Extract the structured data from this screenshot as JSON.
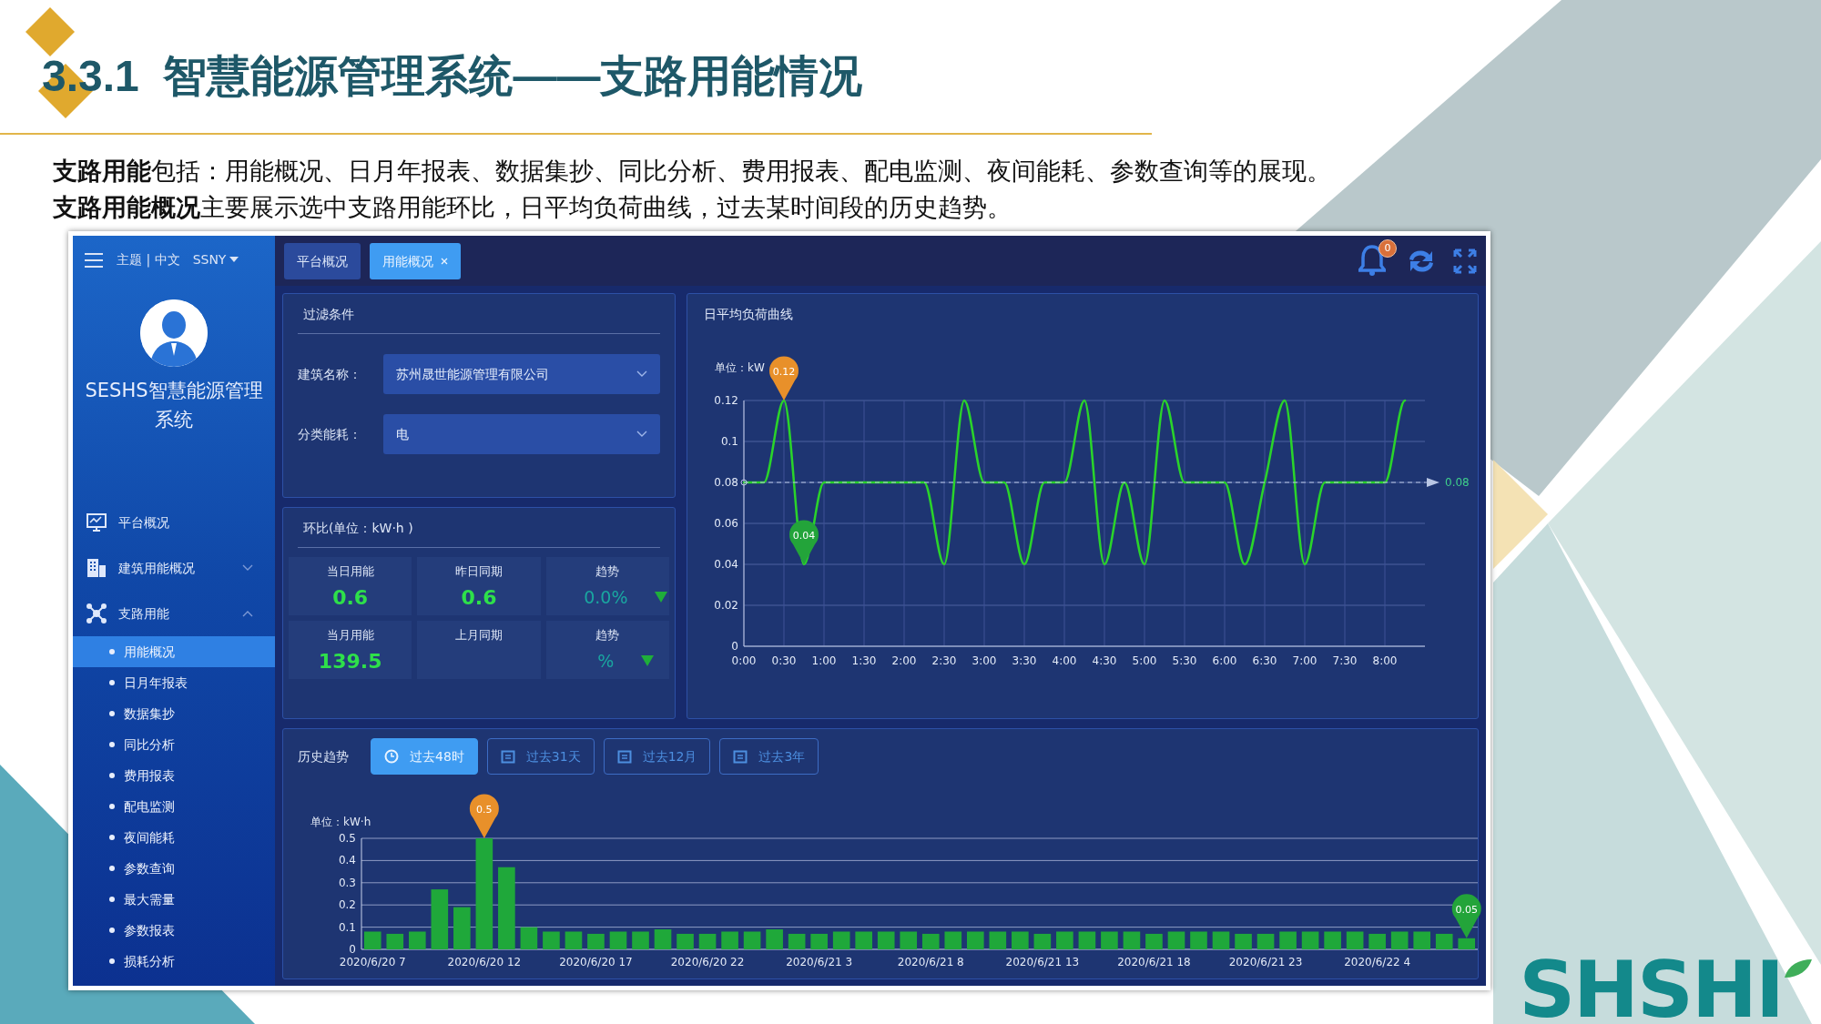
{
  "slide": {
    "title": "3.3.1  智慧能源管理系统——支路用能情况",
    "paragraphs": [
      "**支路用能**包括：用能概况、日月年报表、数据集抄、同比分析、费用报表、配电监测、夜间能耗、参数查询等的展现。",
      "**支路用能概况**主要展示选中支路用能环比，日平均负荷曲线，过去某时间段的历史趋势。"
    ],
    "logo": "SHSHI"
  },
  "app": {
    "topbar": {
      "theme_language": "主题 | 中文",
      "user": "SSNY",
      "notification_count": "0"
    },
    "tabs": [
      {
        "label": "平台概况",
        "selected": false,
        "closable": false
      },
      {
        "label": "用能概况",
        "selected": true,
        "closable": true
      }
    ],
    "sidebar": {
      "system_name": "SESHS智慧能源管理系统",
      "items": [
        {
          "label": "平台概况",
          "selected": false
        },
        {
          "label": "建筑用能概况",
          "selected": false,
          "expanded": false
        },
        {
          "label": "支路用能",
          "selected": false,
          "expanded": true,
          "children": [
            {
              "label": "用能概况",
              "selected": true
            },
            {
              "label": "日月年报表",
              "selected": false
            },
            {
              "label": "数据集抄",
              "selected": false
            },
            {
              "label": "同比分析",
              "selected": false
            },
            {
              "label": "费用报表",
              "selected": false
            },
            {
              "label": "配电监测",
              "selected": false
            },
            {
              "label": "夜间能耗",
              "selected": false
            },
            {
              "label": "参数查询",
              "selected": false
            },
            {
              "label": "最大需量",
              "selected": false
            },
            {
              "label": "参数报表",
              "selected": false
            },
            {
              "label": "损耗分析",
              "selected": false
            }
          ]
        }
      ]
    },
    "filter": {
      "title": "过滤条件",
      "fields": [
        {
          "label": "建筑名称：",
          "value": "苏州晟世能源管理有限公司"
        },
        {
          "label": "分类能耗：",
          "value": "电"
        }
      ]
    },
    "ring_comparison": {
      "title": "环比(单位：kW·h )",
      "rows": [
        {
          "cells": [
            {
              "kind": "value",
              "label": "当日用能",
              "value": "0.6"
            },
            {
              "kind": "value",
              "label": "昨日同期",
              "value": "0.6"
            },
            {
              "kind": "trend",
              "label": "趋势",
              "value": "0.0%",
              "falling": true
            }
          ]
        },
        {
          "cells": [
            {
              "kind": "value",
              "label": "当月用能",
              "value": "139.5"
            },
            {
              "kind": "value",
              "label": "上月同期"
            },
            {
              "kind": "trend",
              "label": "趋势",
              "value": "%",
              "falling": true
            }
          ]
        }
      ]
    },
    "load_curve": {
      "title": "日平均负荷曲线",
      "markers": [
        {
          "kind": "max",
          "label": "0.12"
        },
        {
          "kind": "min",
          "label": "0.04"
        }
      ],
      "chart_data": {
        "type": "line",
        "ylabel": "单位：kW",
        "grid": true,
        "x": [
          0,
          0.25,
          0.5,
          0.75,
          1,
          1.25,
          1.5,
          1.75,
          2,
          2.25,
          2.5,
          2.75,
          3,
          3.25,
          3.5,
          3.75,
          4,
          4.25,
          4.5,
          4.75,
          5,
          5.25,
          5.5,
          5.75,
          6,
          6.25,
          6.5,
          6.75,
          7,
          7.25,
          7.5,
          7.75,
          8,
          8.25
        ],
        "series": [
          {
            "color": "#2ad42a",
            "values": [
              0.08,
              0.08,
              0.12,
              0.04,
              0.08,
              0.08,
              0.08,
              0.08,
              0.08,
              0.08,
              0.04,
              0.12,
              0.08,
              0.08,
              0.04,
              0.08,
              0.08,
              0.12,
              0.04,
              0.08,
              0.04,
              0.12,
              0.08,
              0.08,
              0.08,
              0.04,
              0.08,
              0.12,
              0.04,
              0.08,
              0.08,
              0.08,
              0.08,
              0.12
            ]
          }
        ],
        "xlim": [
          0,
          8.5
        ],
        "ylim": [
          0,
          0.12
        ],
        "yticks": [
          0,
          0.02,
          0.04,
          0.06,
          0.08,
          0.1,
          0.12
        ],
        "xticks": [
          {
            "value": 0,
            "label": "0:00"
          },
          {
            "value": 0.5,
            "label": "0:30"
          },
          {
            "value": 1,
            "label": "1:00"
          },
          {
            "value": 1.5,
            "label": "1:30"
          },
          {
            "value": 2,
            "label": "2:00"
          },
          {
            "value": 2.5,
            "label": "2:30"
          },
          {
            "value": 3,
            "label": "3:00"
          },
          {
            "value": 3.5,
            "label": "3:30"
          },
          {
            "value": 4,
            "label": "4:00"
          },
          {
            "value": 4.5,
            "label": "4:30"
          },
          {
            "value": 5,
            "label": "5:00"
          },
          {
            "value": 5.5,
            "label": "5:30"
          },
          {
            "value": 6,
            "label": "6:00"
          },
          {
            "value": 6.5,
            "label": "6:30"
          },
          {
            "value": 7,
            "label": "7:00"
          },
          {
            "value": 7.5,
            "label": "7:30"
          },
          {
            "value": 8,
            "label": "8:00"
          }
        ],
        "ref_lines": [
          {
            "axis": "y",
            "value": 0.08,
            "label": "0.08"
          }
        ]
      }
    },
    "history": {
      "title": "历史趋势",
      "buttons": [
        {
          "label": "过去48时",
          "selected": true,
          "kind": "clock"
        },
        {
          "label": "过去31天",
          "selected": false,
          "kind": "calendar"
        },
        {
          "label": "过去12月",
          "selected": false,
          "kind": "calendar"
        },
        {
          "label": "过去3年",
          "selected": false,
          "kind": "calendar"
        }
      ],
      "markers": [
        {
          "kind": "max",
          "label": "0.5"
        },
        {
          "kind": "min",
          "label": "0.05"
        }
      ],
      "chart_data": {
        "type": "bar",
        "ylabel": "单位：kW·h",
        "grid": true,
        "categories": [
          "2020/6/20 7",
          null,
          null,
          null,
          null,
          "2020/6/20 12",
          null,
          null,
          null,
          null,
          "2020/6/20 17",
          null,
          null,
          null,
          null,
          "2020/6/20 22",
          null,
          null,
          null,
          null,
          "2020/6/21 3",
          null,
          null,
          null,
          null,
          "2020/6/21 8",
          null,
          null,
          null,
          null,
          "2020/6/21 13",
          null,
          null,
          null,
          null,
          "2020/6/21 18",
          null,
          null,
          null,
          null,
          "2020/6/21 23",
          null,
          null,
          null,
          null,
          "2020/6/22 4",
          null,
          null,
          null,
          null
        ],
        "series": [
          {
            "color": "#1fa83a",
            "values": [
              0.08,
              0.07,
              0.08,
              0.27,
              0.19,
              0.5,
              0.37,
              0.1,
              0.08,
              0.08,
              0.07,
              0.08,
              0.08,
              0.09,
              0.07,
              0.07,
              0.08,
              0.08,
              0.09,
              0.07,
              0.07,
              0.08,
              0.08,
              0.08,
              0.08,
              0.07,
              0.08,
              0.08,
              0.08,
              0.08,
              0.07,
              0.08,
              0.08,
              0.08,
              0.08,
              0.07,
              0.08,
              0.08,
              0.08,
              0.07,
              0.07,
              0.08,
              0.08,
              0.08,
              0.08,
              0.07,
              0.08,
              0.08,
              0.07,
              0.05
            ]
          }
        ],
        "ylim": [
          0,
          0.5
        ],
        "yticks": [
          0,
          0.1,
          0.2,
          0.3,
          0.4,
          0.5
        ]
      }
    }
  }
}
